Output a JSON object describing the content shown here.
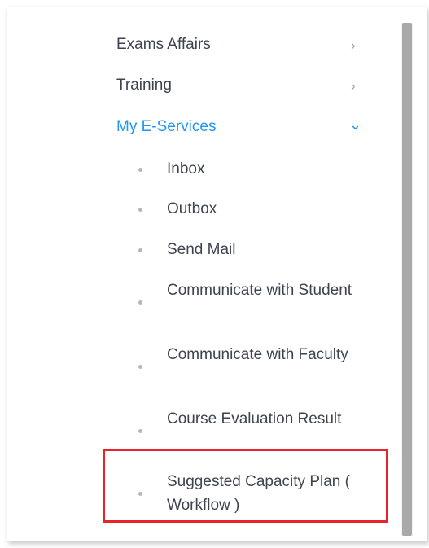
{
  "menu": {
    "items": [
      {
        "label": "Exams Affairs",
        "icon": "chevron-right-icon",
        "glyph": "›"
      },
      {
        "label": "Training",
        "icon": "chevron-right-icon",
        "glyph": "›"
      },
      {
        "label": "My E-Services",
        "icon": "chevron-down-icon",
        "glyph": "⌄",
        "expanded": true
      }
    ],
    "subitems": [
      {
        "label": "Inbox"
      },
      {
        "label": "Outbox"
      },
      {
        "label": "Send Mail"
      },
      {
        "label": "Communicate with Student"
      },
      {
        "label": "Communicate with Faculty"
      },
      {
        "label": "Course Evaluation Result"
      },
      {
        "label": "Suggested Capacity Plan ( Workflow )",
        "highlighted": true
      }
    ]
  },
  "colors": {
    "active": "#2196f3",
    "text": "#3d4450",
    "highlight_border": "#e8242a"
  }
}
